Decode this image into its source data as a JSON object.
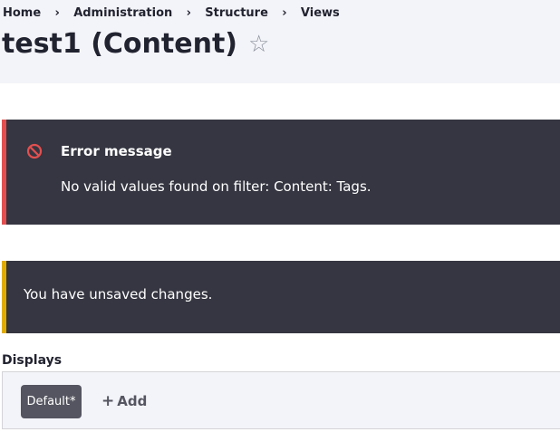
{
  "breadcrumb": {
    "items": [
      "Home",
      "Administration",
      "Structure",
      "Views"
    ],
    "separator": "›"
  },
  "page": {
    "title": "test1 (Content)",
    "favorite_icon": "star-outline-icon"
  },
  "messages": {
    "error": {
      "title": "Error message",
      "text": "No valid values found on filter: Content: Tags.",
      "icon": "error-circle-slash-icon",
      "accent_color": "#e34f4f"
    },
    "warning": {
      "text": "You have unsaved changes.",
      "accent_color": "#e0ac00"
    },
    "background_color": "#353641"
  },
  "displays": {
    "label": "Displays",
    "tabs": [
      {
        "label": "Default*",
        "active": true
      }
    ],
    "add_label": "Add",
    "add_icon": "plus-icon"
  }
}
